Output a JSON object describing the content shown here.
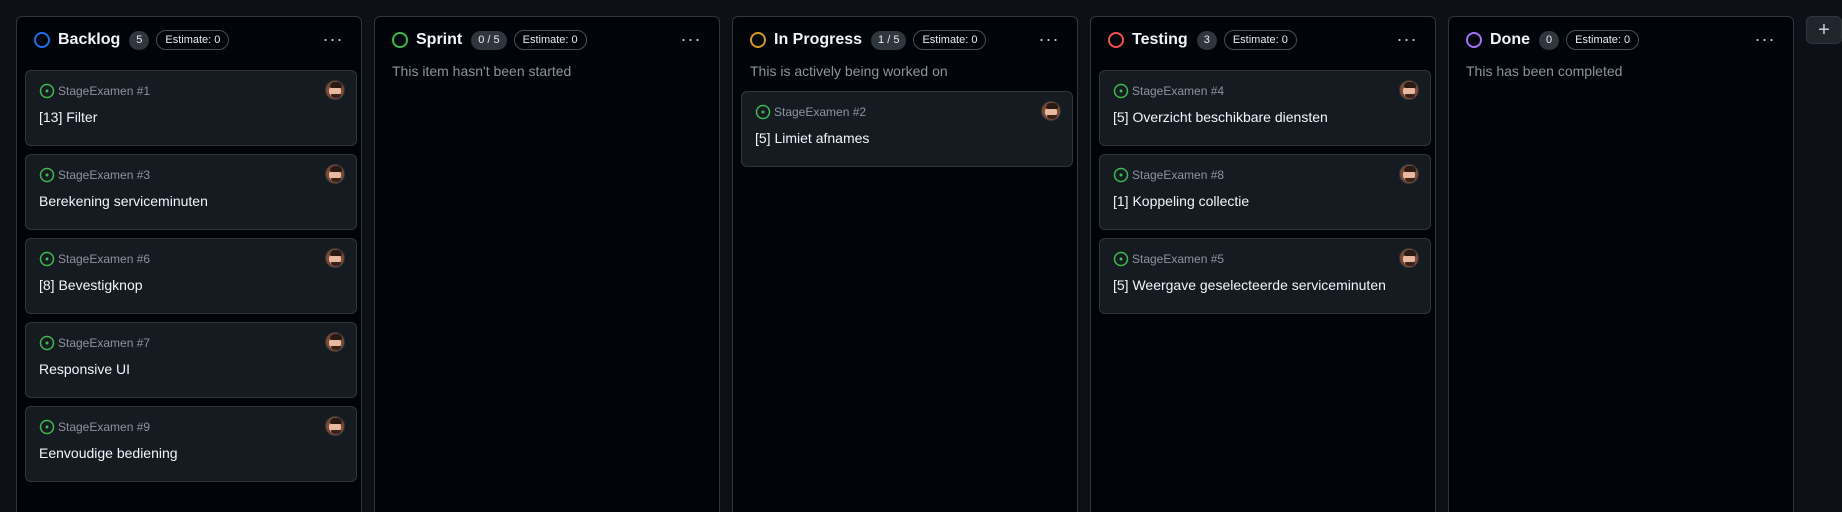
{
  "colors": {
    "backlog": "#1f6feb",
    "sprint": "#3fb950",
    "in_progress": "#d29922",
    "testing": "#f85149",
    "done": "#a371f7",
    "issue_open": "#3fb950"
  },
  "icons": {
    "menu": "ellipsis-icon",
    "add": "plus-icon",
    "issue": "issue-opened-icon",
    "avatar": "user-avatar"
  },
  "menu_glyph": "···",
  "add_glyph": "+",
  "columns": [
    {
      "title": "Backlog",
      "count": "5",
      "estimate": "Estimate: 0",
      "description": "",
      "cards": [
        {
          "ref": "StageExamen #1",
          "title": "[13] Filter"
        },
        {
          "ref": "StageExamen #3",
          "title": "Berekening serviceminuten"
        },
        {
          "ref": "StageExamen #6",
          "title": "[8] Bevestigknop"
        },
        {
          "ref": "StageExamen #7",
          "title": "Responsive UI"
        },
        {
          "ref": "StageExamen #9",
          "title": "Eenvoudige bediening"
        }
      ]
    },
    {
      "title": "Sprint",
      "count": "0 / 5",
      "estimate": "Estimate: 0",
      "description": "This item hasn't been started",
      "cards": []
    },
    {
      "title": "In Progress",
      "count": "1 / 5",
      "estimate": "Estimate: 0",
      "description": "This is actively being worked on",
      "cards": [
        {
          "ref": "StageExamen #2",
          "title": "[5] Limiet afnames"
        }
      ]
    },
    {
      "title": "Testing",
      "count": "3",
      "estimate": "Estimate: 0",
      "description": "",
      "cards": [
        {
          "ref": "StageExamen #4",
          "title": "[5] Overzicht beschikbare diensten"
        },
        {
          "ref": "StageExamen #8",
          "title": "[1] Koppeling collectie"
        },
        {
          "ref": "StageExamen #5",
          "title": "[5] Weergave geselecteerde serviceminuten"
        }
      ]
    },
    {
      "title": "Done",
      "count": "0",
      "estimate": "Estimate: 0",
      "description": "This has been completed",
      "cards": []
    }
  ]
}
